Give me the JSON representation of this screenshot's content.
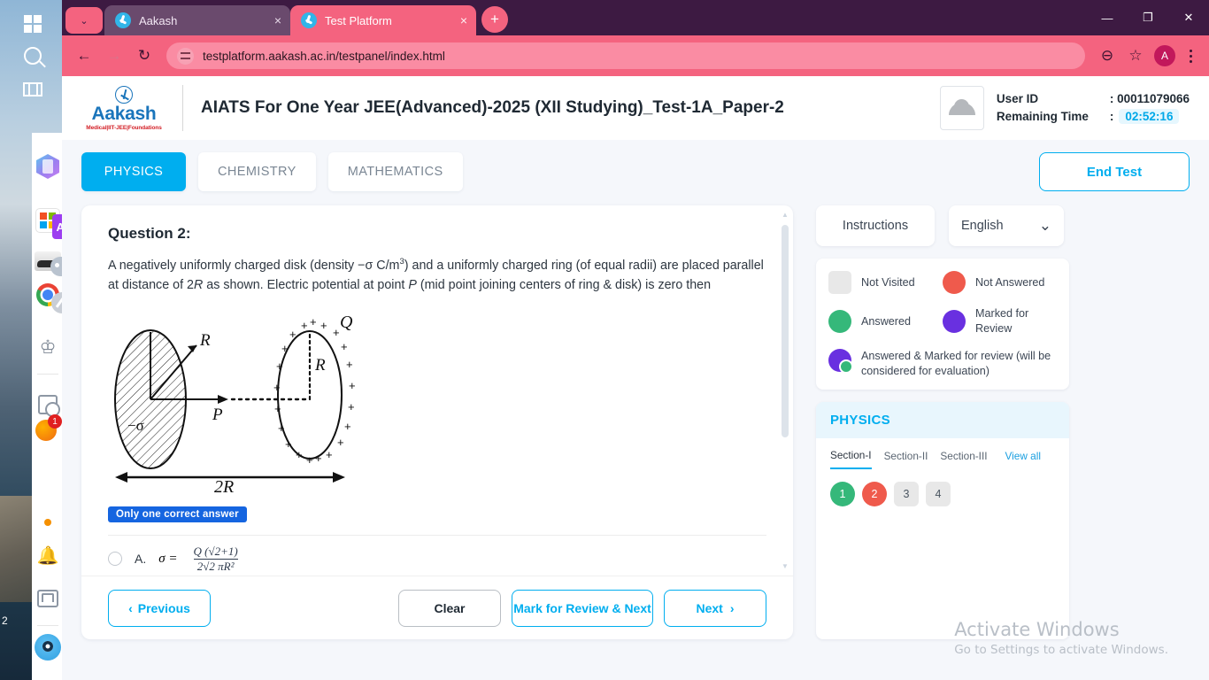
{
  "browser": {
    "tabs": [
      {
        "title": "Aakash",
        "active": false
      },
      {
        "title": "Test Platform",
        "active": true
      }
    ],
    "new_tab_label": "+",
    "close_label": "×",
    "chevron_label": "⌄",
    "url": "testplatform.aakash.ac.in/testpanel/index.html",
    "back_label": "←",
    "forward_label": "→",
    "reload_label": "↻",
    "zoom_out_label": "⊖",
    "bookmark_label": "☆",
    "profile_initial": "A",
    "window_minimize": "—",
    "window_restore": "❐",
    "window_close": "✕"
  },
  "header": {
    "logo_brand": "Aakash",
    "logo_tagline": "Medical|IIT-JEE|Foundations",
    "exam_title": "AIATS For One Year JEE(Advanced)-2025 (XII Studying)_Test-1A_Paper-2",
    "user_id_label": "User ID",
    "user_id_value": ": 00011079066",
    "remaining_time_label": "Remaining Time",
    "remaining_time_colon": ":",
    "remaining_time_value": "02:52:16"
  },
  "subjects": {
    "tabs": [
      {
        "label": "PHYSICS",
        "active": true
      },
      {
        "label": "CHEMISTRY",
        "active": false
      },
      {
        "label": "MATHEMATICS",
        "active": false
      }
    ],
    "end_test_label": "End Test"
  },
  "question": {
    "title": "Question 2:",
    "text_part1": "A negatively uniformly charged disk (density −σ C/m",
    "text_sup": "3",
    "text_part2": ") and a uniformly charged ring (of equal radii) are placed parallel at distance of 2",
    "text_italic_R": "R",
    "text_part3": " as shown. Electric potential at point ",
    "text_italic_P": "P",
    "text_part4": " (mid point joining centers of ring & disk) is zero then",
    "figure": {
      "label_disk_density": "−σ",
      "label_disk_radius": "R",
      "label_point_p": "P",
      "label_ring_charge": "Q",
      "label_ring_radius": "R",
      "label_distance": "2R",
      "plus_sign": "+"
    },
    "answer_type_badge": "Only one correct answer",
    "options": [
      {
        "key": "A.",
        "lhs": "σ =",
        "numerator": "Q (√2+1)",
        "denominator": "2√2 πR²"
      }
    ]
  },
  "footer": {
    "previous_label": "Previous",
    "previous_icon": "‹",
    "clear_label": "Clear",
    "mark_review_label": "Mark for Review & Next",
    "next_label": "Next",
    "next_icon": "›"
  },
  "right_panel": {
    "instructions_label": "Instructions",
    "language_value": "English",
    "language_chevron": "⌄",
    "legend": [
      {
        "label": "Not Visited",
        "type": "notvisited"
      },
      {
        "label": "Not Answered",
        "type": "notanswered"
      },
      {
        "label": "Answered",
        "type": "answered"
      },
      {
        "label": "Marked for Review",
        "type": "review"
      },
      {
        "label": "Answered & Marked for review (will be considered for evaluation)",
        "type": "ansreview"
      }
    ],
    "palette_subject": "PHYSICS",
    "section_tabs": [
      {
        "label": "Section-I",
        "active": true
      },
      {
        "label": "Section-II",
        "active": false
      },
      {
        "label": "Section-III",
        "active": false
      }
    ],
    "view_all_label": "View all",
    "question_numbers": [
      {
        "n": "1",
        "state": "answered"
      },
      {
        "n": "2",
        "state": "notanswered"
      },
      {
        "n": "3",
        "state": "notvisited"
      },
      {
        "n": "4",
        "state": "notvisited"
      }
    ]
  },
  "watermark": {
    "line1": "Activate Windows",
    "line2": "Go to Settings to activate Windows."
  },
  "taskbar": {
    "desktop_number": "2",
    "badge_count": "1"
  },
  "colors": {
    "accent_blue": "#00aeef",
    "browser_pink": "#f4637f",
    "titlebar_purple": "#3d1a42",
    "answered_green": "#35b87a",
    "not_answered_red": "#ef5a4c",
    "review_purple": "#6930e0"
  }
}
